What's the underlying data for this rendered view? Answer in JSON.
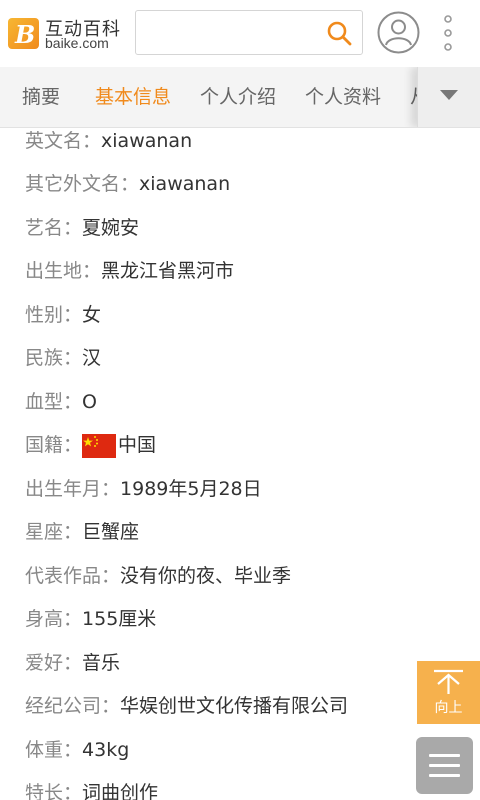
{
  "header": {
    "logo_cn": "互动百科",
    "logo_en": "baike.com",
    "logo_glyph": "B",
    "search_value": "",
    "search_placeholder": ""
  },
  "tabs": [
    {
      "label": "摘要",
      "active": false
    },
    {
      "label": "基本信息",
      "active": true
    },
    {
      "label": "个人介绍",
      "active": false
    },
    {
      "label": "个人资料",
      "active": false
    },
    {
      "label": "从",
      "active": false
    }
  ],
  "info": [
    {
      "label": "英文名",
      "value": "xiawanan"
    },
    {
      "label": "其它外文名",
      "value": "xiawanan"
    },
    {
      "label": "艺名",
      "value": "夏婉安"
    },
    {
      "label": "出生地",
      "value": "黑龙江省黑河市"
    },
    {
      "label": "性别",
      "value": "女"
    },
    {
      "label": "民族",
      "value": "汉"
    },
    {
      "label": "血型",
      "value": "O"
    },
    {
      "label": "国籍",
      "value": "中国",
      "flag": "china-flag-icon"
    },
    {
      "label": "出生年月",
      "value": "1989年5月28日"
    },
    {
      "label": "星座",
      "value": "巨蟹座"
    },
    {
      "label": "代表作品",
      "value": "没有你的夜、毕业季"
    },
    {
      "label": "身高",
      "value": "155厘米"
    },
    {
      "label": "爱好",
      "value": "音乐"
    },
    {
      "label": "经纪公司",
      "value": "华娱创世文化传播有限公司"
    },
    {
      "label": "体重",
      "value": "43kg"
    },
    {
      "label": "特长",
      "value": "词曲创作"
    }
  ],
  "colon": "：",
  "back_to_top": {
    "label": "向上"
  },
  "colors": {
    "accent": "#f08a1c",
    "up_button": "#f6b14d",
    "menu_button": "#a9a9a9"
  },
  "icons": [
    "search-icon",
    "avatar-icon",
    "more-vertical-icon",
    "chevron-down-icon",
    "arrow-up-icon",
    "menu-icon"
  ]
}
